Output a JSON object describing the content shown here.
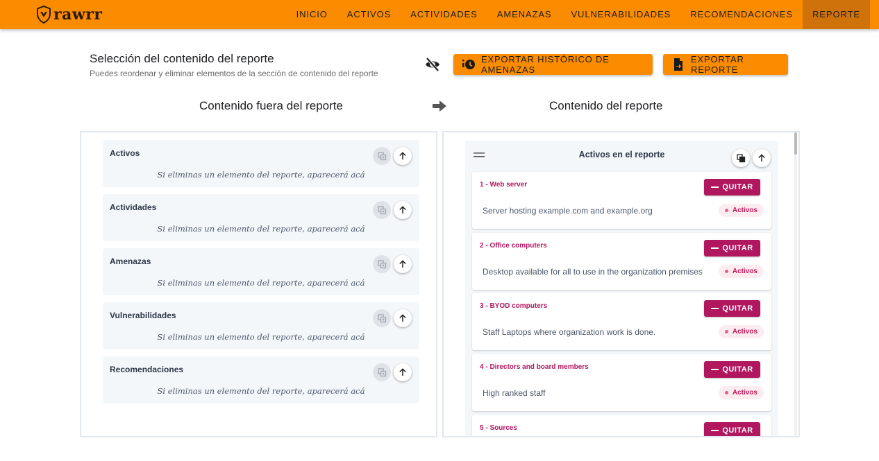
{
  "brand": {
    "name": "rawrr",
    "accent": "#fb8c00",
    "active_tab_bg": "#d0720a",
    "remove_color": "#b0175e"
  },
  "nav": [
    {
      "label": "INICIO"
    },
    {
      "label": "ACTIVOS"
    },
    {
      "label": "ACTIVIDADES"
    },
    {
      "label": "AMENAZAS"
    },
    {
      "label": "VULNERABILIDADES"
    },
    {
      "label": "RECOMENDACIONES"
    },
    {
      "label": "REPORTE",
      "active": true
    }
  ],
  "header": {
    "title": "Selección del contenido del reporte",
    "subtitle": "Puedes reordenar y eliminar elementos de la sección de contenido del reporte",
    "export_history_label": "EXPORTAR HISTÓRICO DE AMENAZAS",
    "export_report_label": "EXPORTAR REPORTE",
    "icons": {
      "visibility": "eye-off-icon",
      "history": "history-clock-icon",
      "report": "file-export-icon"
    }
  },
  "columns": {
    "outside_title": "Contenido fuera del reporte",
    "inside_title": "Contenido del reporte"
  },
  "outside": {
    "empty_message": "Si eliminas un elemento del reporte, aparecerá acá",
    "sections": [
      {
        "title": "Activos"
      },
      {
        "title": "Actividades"
      },
      {
        "title": "Amenazas"
      },
      {
        "title": "Vulnerabilidades"
      },
      {
        "title": "Recomendaciones"
      }
    ]
  },
  "inside": {
    "group_title": "Activos en el reporte",
    "remove_label": "QUITAR",
    "items": [
      {
        "title": "1 - Web server",
        "description": "Server hosting example.com and example.org",
        "tag": "Activos"
      },
      {
        "title": "2 - Office computers",
        "description": "Desktop available for all to use in the organization premises",
        "tag": "Activos"
      },
      {
        "title": "3 - BYOD computers",
        "description": "Staff Laptops where organization work is done.",
        "tag": "Activos"
      },
      {
        "title": "4 - Directors and board members",
        "description": "High ranked staff",
        "tag": "Activos"
      },
      {
        "title": "5 - Sources",
        "description": "",
        "tag": ""
      }
    ]
  }
}
